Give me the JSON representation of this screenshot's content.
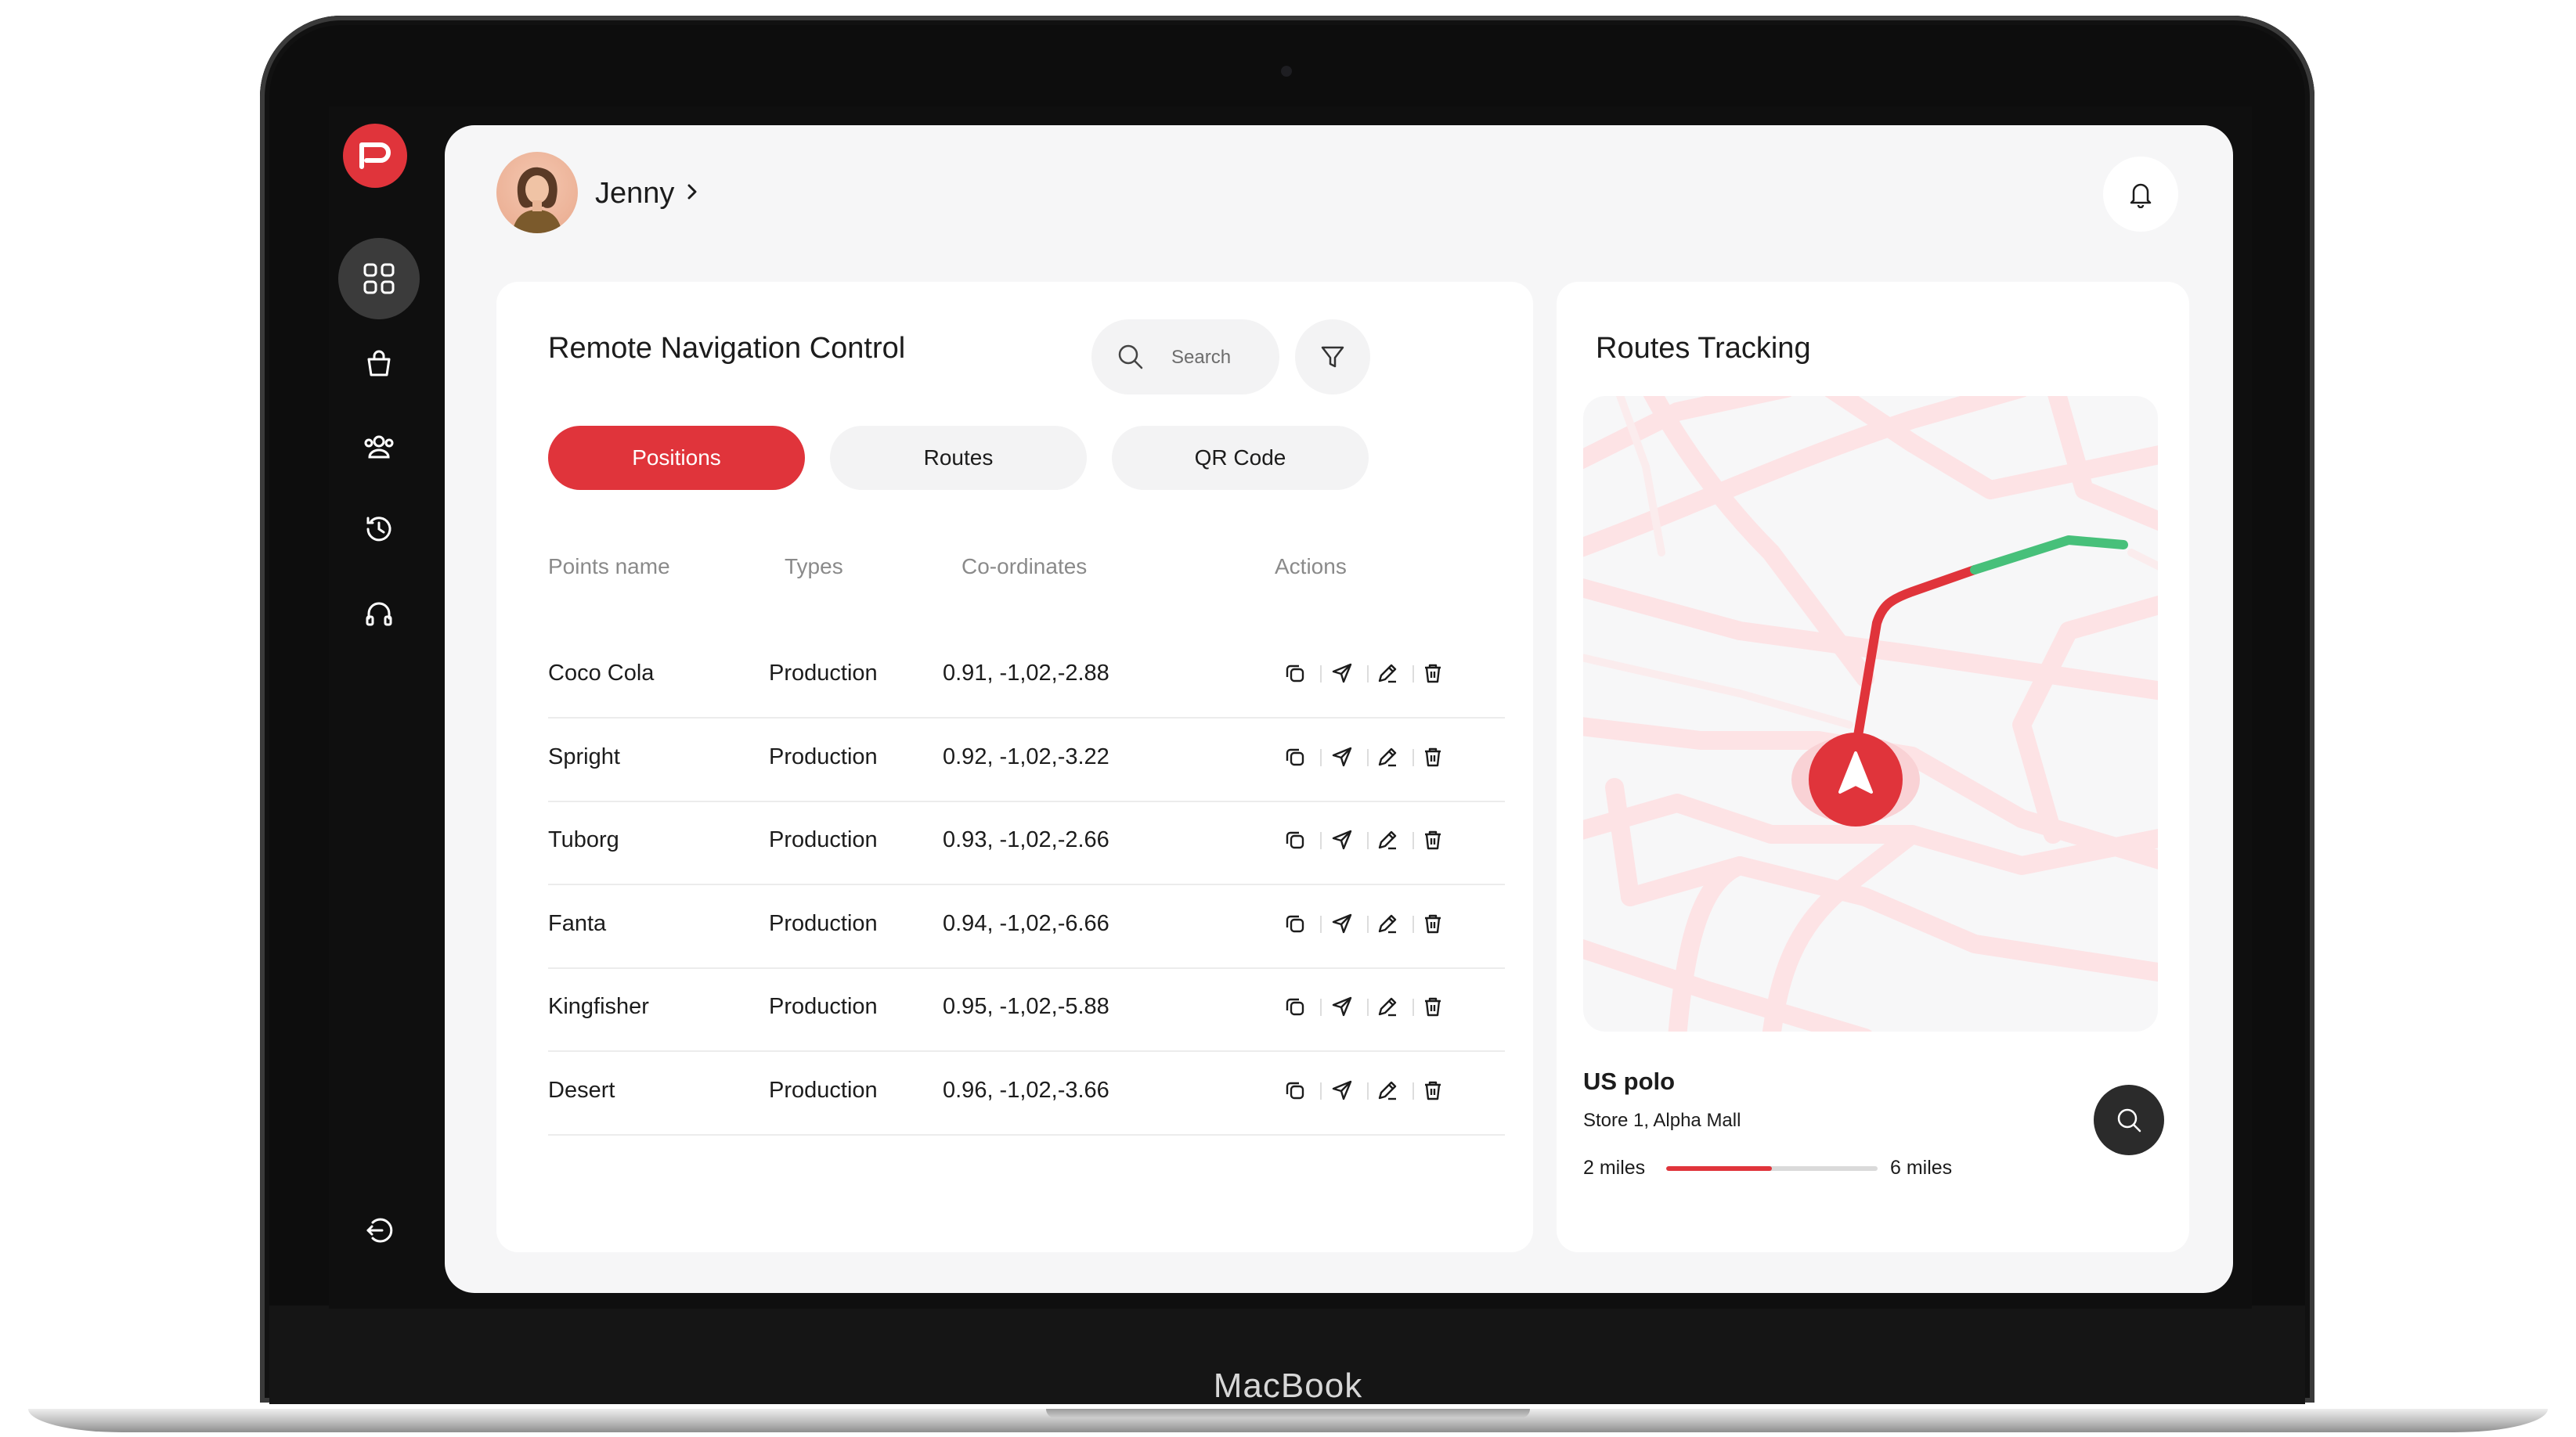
{
  "device": {
    "brand": "MacBook"
  },
  "sidebar": {
    "logo_letter": "P",
    "items": [
      {
        "id": "dashboard",
        "icon": "grid-icon",
        "active": true
      },
      {
        "id": "shop",
        "icon": "shopping-bag-icon",
        "active": false
      },
      {
        "id": "users",
        "icon": "users-icon",
        "active": false
      },
      {
        "id": "history",
        "icon": "history-icon",
        "active": false
      },
      {
        "id": "support",
        "icon": "headphones-icon",
        "active": false
      }
    ],
    "logout_icon": "logout-icon"
  },
  "header": {
    "username": "Jenny"
  },
  "control": {
    "title": "Remote Navigation Control",
    "search_placeholder": "Search",
    "tabs": [
      {
        "label": "Positions",
        "active": true
      },
      {
        "label": "Routes",
        "active": false
      },
      {
        "label": "QR Code",
        "active": false
      }
    ],
    "columns": [
      "Points name",
      "Types",
      "Co-ordinates",
      "Actions"
    ],
    "rows": [
      {
        "name": "Coco Cola",
        "type": "Production",
        "coords": "0.91, -1,02,-2.88"
      },
      {
        "name": "Spright",
        "type": "Production",
        "coords": "0.92, -1,02,-3.22"
      },
      {
        "name": "Tuborg",
        "type": "Production",
        "coords": "0.93, -1,02,-2.66"
      },
      {
        "name": "Fanta",
        "type": "Production",
        "coords": "0.94, -1,02,-6.66"
      },
      {
        "name": "Kingfisher",
        "type": "Production",
        "coords": "0.95, -1,02,-5.88"
      },
      {
        "name": "Desert",
        "type": "Production",
        "coords": "0.96, -1,02,-3.66"
      }
    ]
  },
  "tracking": {
    "title": "Routes Tracking",
    "place_name": "US polo",
    "place_address": "Store 1, Alpha Mall",
    "distance_start": "2 miles",
    "distance_end": "6 miles",
    "progress": 0.5
  },
  "colors": {
    "accent": "#e0343b",
    "route_green": "#47c07a",
    "dark_button": "#2b2b2b",
    "road": "#fde3e5"
  }
}
